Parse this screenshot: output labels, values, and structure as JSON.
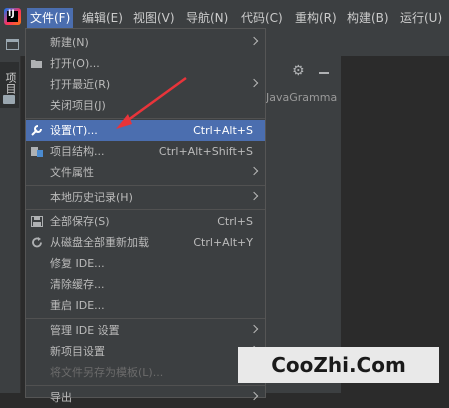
{
  "menubar": {
    "items": [
      {
        "label": "文件(F)"
      },
      {
        "label": "编辑(E)"
      },
      {
        "label": "视图(V)"
      },
      {
        "label": "导航(N)"
      },
      {
        "label": "代码(C)"
      },
      {
        "label": "重构(R)"
      },
      {
        "label": "构建(B)"
      },
      {
        "label": "运行(U)"
      }
    ],
    "active_color": "#4b6eaf"
  },
  "side_panel": {
    "project_tab_label": "项目",
    "tree_text": "JavaGramma"
  },
  "icons": {
    "app_logo": "intellij-logo-icon",
    "gear": "gear-icon",
    "minimize": "minimize-icon"
  },
  "file_menu": {
    "items": [
      {
        "label": "新建(N)",
        "shortcut": "",
        "submenu": true
      },
      {
        "label": "打开(O)...",
        "shortcut": "",
        "icon": "folder-open-icon"
      },
      {
        "label": "打开最近(R)",
        "shortcut": "",
        "submenu": true
      },
      {
        "label": "关闭项目(J)",
        "shortcut": ""
      },
      {
        "label": "设置(T)...",
        "shortcut": "Ctrl+Alt+S",
        "icon": "wrench-icon",
        "selected": true
      },
      {
        "label": "项目结构...",
        "shortcut": "Ctrl+Alt+Shift+S",
        "icon": "project-structure-icon"
      },
      {
        "label": "文件属性",
        "shortcut": "",
        "submenu": true
      },
      {
        "label": "本地历史记录(H)",
        "shortcut": "",
        "submenu": true
      },
      {
        "label": "全部保存(S)",
        "shortcut": "Ctrl+S",
        "icon": "save-icon"
      },
      {
        "label": "从磁盘全部重新加载",
        "shortcut": "Ctrl+Alt+Y",
        "icon": "reload-icon"
      },
      {
        "label": "修复 IDE...",
        "shortcut": ""
      },
      {
        "label": "清除缓存...",
        "shortcut": ""
      },
      {
        "label": "重启 IDE...",
        "shortcut": ""
      },
      {
        "label": "管理 IDE 设置",
        "shortcut": "",
        "submenu": true
      },
      {
        "label": "新项目设置",
        "shortcut": "",
        "submenu": true
      },
      {
        "label": "将文件另存为模板(L)...",
        "shortcut": "",
        "disabled": true
      },
      {
        "label": "导出",
        "shortcut": "",
        "submenu": true
      }
    ]
  },
  "watermark": {
    "text": "CooZhi.Com"
  },
  "annotation": {
    "arrow_color": "#e8343a"
  }
}
